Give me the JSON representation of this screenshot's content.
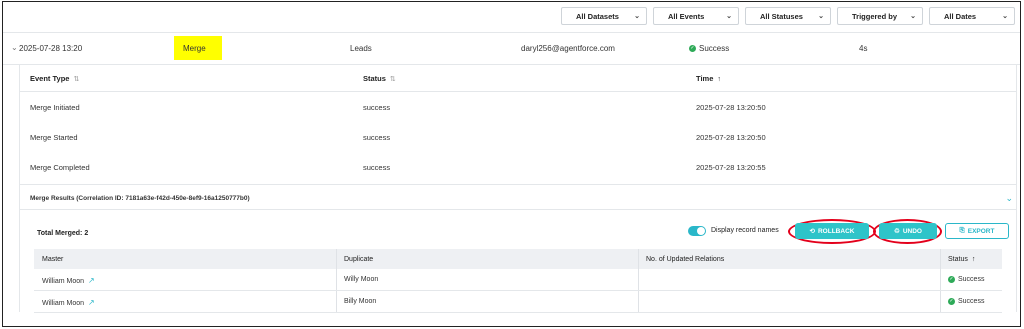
{
  "filters": [
    {
      "label": "All Datasets"
    },
    {
      "label": "All Events"
    },
    {
      "label": "All Statuses"
    },
    {
      "label": "Triggered by"
    },
    {
      "label": "All Dates"
    }
  ],
  "summary": {
    "timestamp": "2025-07-28 13:20",
    "action": "Merge",
    "dataset": "Leads",
    "user": "daryl256@agentforce.com",
    "status": "Success",
    "duration": "4s"
  },
  "events": {
    "headers": {
      "event_type": "Event Type",
      "status": "Status",
      "time": "Time"
    },
    "rows": [
      {
        "event_type": "Merge Initiated",
        "status": "success",
        "time": "2025-07-28 13:20:50"
      },
      {
        "event_type": "Merge Started",
        "status": "success",
        "time": "2025-07-28 13:20:50"
      },
      {
        "event_type": "Merge Completed",
        "status": "success",
        "time": "2025-07-28 13:20:55"
      }
    ]
  },
  "results": {
    "title": "Merge Results (Correlation ID: 7181a63e-f42d-450e-8ef9-16a1250777b0)",
    "total": "Total Merged: 2",
    "toggle_label": "Display record names",
    "buttons": {
      "rollback": "ROLLBACK",
      "undo": "UNDO",
      "export": "EXPORT"
    },
    "headers": {
      "master": "Master",
      "duplicate": "Duplicate",
      "relations": "No. of Updated Relations",
      "status": "Status"
    },
    "rows": [
      {
        "master": "William Moon",
        "duplicate": "Willy Moon",
        "relations": "",
        "status": "Success"
      },
      {
        "master": "William Moon",
        "duplicate": "Billy Moon",
        "relations": "",
        "status": "Success"
      }
    ]
  },
  "colors": {
    "accent": "#2ec4c9",
    "success": "#2eaa58",
    "highlight": "#ffff00",
    "annotation": "#e3001b"
  }
}
